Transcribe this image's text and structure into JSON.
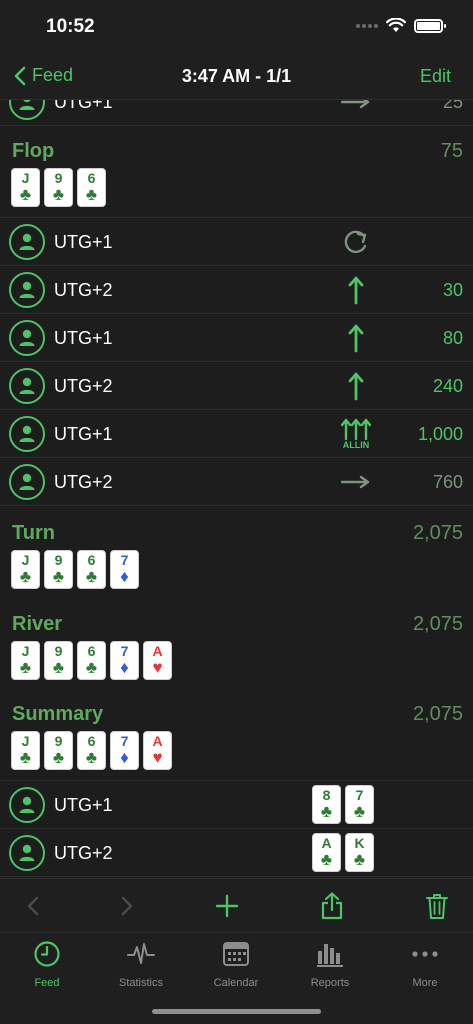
{
  "status": {
    "time": "10:52"
  },
  "nav": {
    "back_label": "Feed",
    "title": "3:47 AM - 1/1",
    "edit_label": "Edit"
  },
  "prev_row": {
    "player": "UTG+1",
    "action": "call",
    "amount": "25"
  },
  "flop": {
    "title": "Flop",
    "pot": "75",
    "cards": [
      {
        "rank": "J",
        "suit": "♣",
        "color": "#2e7d32"
      },
      {
        "rank": "9",
        "suit": "♣",
        "color": "#2e7d32"
      },
      {
        "rank": "6",
        "suit": "♣",
        "color": "#2e7d32"
      }
    ],
    "actions": [
      {
        "player": "UTG+1",
        "action": "check",
        "amount": ""
      },
      {
        "player": "UTG+2",
        "action": "bet",
        "amount": "30"
      },
      {
        "player": "UTG+1",
        "action": "raise",
        "amount": "80"
      },
      {
        "player": "UTG+2",
        "action": "raise",
        "amount": "240"
      },
      {
        "player": "UTG+1",
        "action": "allin",
        "action_label": "ALLIN",
        "amount": "1,000"
      },
      {
        "player": "UTG+2",
        "action": "call",
        "amount": "760"
      }
    ]
  },
  "turn": {
    "title": "Turn",
    "pot": "2,075",
    "cards": [
      {
        "rank": "J",
        "suit": "♣",
        "color": "#2e7d32"
      },
      {
        "rank": "9",
        "suit": "♣",
        "color": "#2e7d32"
      },
      {
        "rank": "6",
        "suit": "♣",
        "color": "#2e7d32"
      },
      {
        "rank": "7",
        "suit": "♦",
        "color": "#2f5ed8"
      }
    ]
  },
  "river": {
    "title": "River",
    "pot": "2,075",
    "cards": [
      {
        "rank": "J",
        "suit": "♣",
        "color": "#2e7d32"
      },
      {
        "rank": "9",
        "suit": "♣",
        "color": "#2e7d32"
      },
      {
        "rank": "6",
        "suit": "♣",
        "color": "#2e7d32"
      },
      {
        "rank": "7",
        "suit": "♦",
        "color": "#2f5ed8"
      },
      {
        "rank": "A",
        "suit": "♥",
        "color": "#e53935"
      }
    ]
  },
  "summary": {
    "title": "Summary",
    "pot": "2,075",
    "cards": [
      {
        "rank": "J",
        "suit": "♣",
        "color": "#2e7d32"
      },
      {
        "rank": "9",
        "suit": "♣",
        "color": "#2e7d32"
      },
      {
        "rank": "6",
        "suit": "♣",
        "color": "#2e7d32"
      },
      {
        "rank": "7",
        "suit": "♦",
        "color": "#2f5ed8"
      },
      {
        "rank": "A",
        "suit": "♥",
        "color": "#e53935"
      }
    ],
    "players": [
      {
        "player": "UTG+1",
        "hole": [
          {
            "rank": "8",
            "suit": "♣",
            "color": "#2e7d32"
          },
          {
            "rank": "7",
            "suit": "♣",
            "color": "#2e7d32"
          }
        ]
      },
      {
        "player": "UTG+2",
        "hole": [
          {
            "rank": "A",
            "suit": "♣",
            "color": "#2e7d32"
          },
          {
            "rank": "K",
            "suit": "♣",
            "color": "#2e7d32"
          }
        ]
      }
    ]
  },
  "toolbar": {
    "icons": [
      "chevron-left-icon",
      "chevron-right-icon",
      "plus-icon",
      "share-icon",
      "trash-icon"
    ]
  },
  "tabs": [
    {
      "label": "Feed",
      "icon": "clock-icon",
      "active": true
    },
    {
      "label": "Statistics",
      "icon": "pulse-icon",
      "active": false
    },
    {
      "label": "Calendar",
      "icon": "calendar-icon",
      "active": false
    },
    {
      "label": "Reports",
      "icon": "bar-chart-icon",
      "active": false
    },
    {
      "label": "More",
      "icon": "more-icon",
      "active": false
    }
  ],
  "colors": {
    "accent": "#4dc467",
    "background": "#1c1d1c",
    "section_title": "#5fa95e",
    "pot": "#5f8e5f"
  }
}
